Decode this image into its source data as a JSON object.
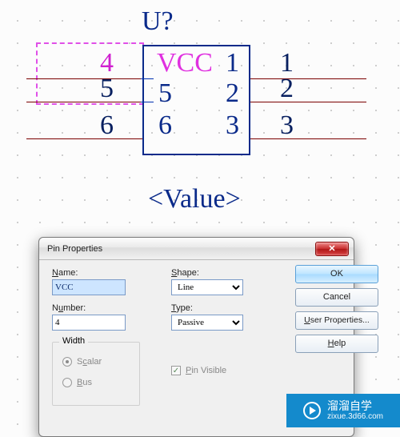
{
  "canvas": {
    "designator": "U?",
    "value_label": "<Value>",
    "part_name": "VCC",
    "inner_left": [
      "5",
      "6"
    ],
    "inner_right": [
      "1",
      "2",
      "3"
    ],
    "outer_left": [
      "4",
      "5",
      "6"
    ],
    "outer_right": [
      "1",
      "2",
      "3"
    ]
  },
  "dialog": {
    "title": "Pin Properties",
    "name_label": "Name:",
    "name_value": "VCC",
    "number_label": "Number:",
    "number_value": "4",
    "shape_label": "Shape:",
    "shape_value": "Line",
    "type_label": "Type:",
    "type_value": "Passive",
    "width_group": "Width",
    "radio_scalar": "Scalar",
    "radio_bus": "Bus",
    "pin_visible": "Pin Visible",
    "pin_visible_checked": true,
    "buttons": {
      "ok": "OK",
      "cancel": "Cancel",
      "user_properties": "User Properties...",
      "help": "Help"
    }
  },
  "watermark": {
    "text": "溜溜自学",
    "url": "zixue.3d66.com"
  }
}
